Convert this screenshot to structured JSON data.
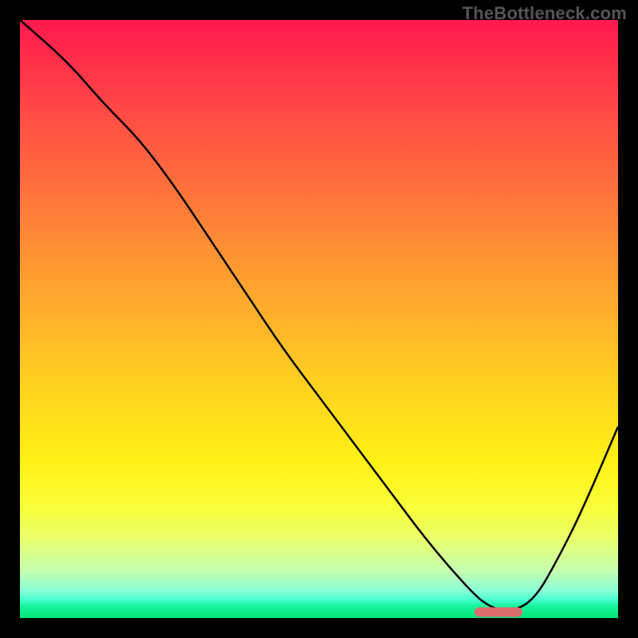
{
  "watermark": "TheBottleneck.com",
  "chart_data": {
    "type": "line",
    "title": "",
    "xlabel": "",
    "ylabel": "",
    "xlim": [
      0,
      100
    ],
    "ylim": [
      0,
      100
    ],
    "grid": false,
    "background": "heat-gradient",
    "gradient_stops": [
      {
        "pct": 0,
        "color": "#ff1a4d"
      },
      {
        "pct": 25,
        "color": "#ff8933"
      },
      {
        "pct": 50,
        "color": "#ffd41f"
      },
      {
        "pct": 80,
        "color": "#f8ff3c"
      },
      {
        "pct": 100,
        "color": "#00e676"
      }
    ],
    "series": [
      {
        "name": "bottleneck-curve",
        "x": [
          0,
          8,
          14,
          20,
          26,
          32,
          38,
          44,
          50,
          56,
          62,
          68,
          74,
          78,
          82,
          86,
          90,
          94,
          100
        ],
        "values": [
          100,
          93,
          86,
          80,
          72,
          63,
          54,
          45,
          37,
          29,
          21,
          13,
          6,
          2,
          1,
          3,
          10,
          18,
          32
        ]
      }
    ],
    "marker": {
      "name": "optimal-range",
      "x_start": 76,
      "x_end": 84,
      "y": 1,
      "color": "#de6b6b"
    }
  }
}
